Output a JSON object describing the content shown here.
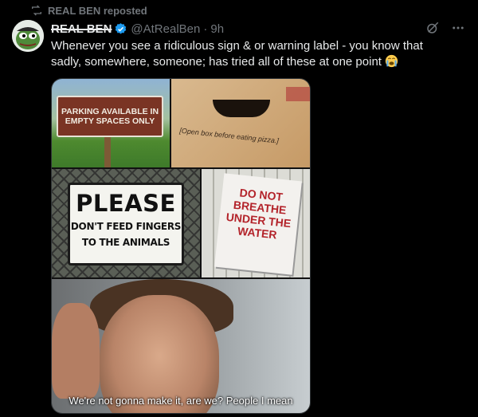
{
  "repost": {
    "label": "REAL BEN reposted"
  },
  "author": {
    "display_name": "REAL BEN",
    "handle": "@AtRealBen",
    "time": "9h"
  },
  "post": {
    "text": "Whenever you see a ridiculous sign & or warning label - you know that sadly, somewhere, someone; has tried all of these at one point",
    "emoji": "loudly-crying-face"
  },
  "images": {
    "parking_sign": "PARKING AVAILABLE IN EMPTY SPACES ONLY",
    "pizza_box": "[Open box before eating pizza.]",
    "please_title": "PLEASE",
    "please_sub_1": "DON'T FEED FINGERS",
    "please_sub_2": "TO THE ANIMALS",
    "breathe_sign": "DO NOT BREATHE UNDER THE WATER",
    "movie_caption": "We're not gonna make it, are we? People I mean"
  },
  "icons": {
    "repost": "repost-icon",
    "verified": "verified-badge-icon",
    "grok": "grok-icon",
    "more": "more-options-icon"
  },
  "colors": {
    "background": "#000000",
    "text": "#e7e9ea",
    "muted": "#71767b",
    "verified": "#1d9bf0"
  }
}
